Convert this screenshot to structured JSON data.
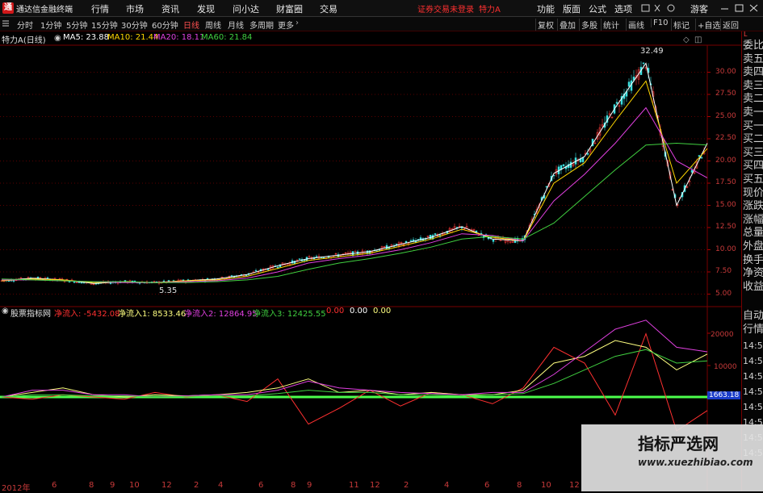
{
  "titlebar": {
    "app_logo": "通",
    "app_title": "通达信金融终端",
    "menus": [
      "行情",
      "市场",
      "资讯",
      "发现",
      "问小达",
      "财富圈",
      "交易"
    ],
    "notice": "证券交易未登录",
    "stock": "特力A",
    "right_items": [
      "功能",
      "版面",
      "公式",
      "选项",
      "游客"
    ]
  },
  "toolbar": {
    "periods": [
      "分时",
      "1分钟",
      "5分钟",
      "15分钟",
      "30分钟",
      "60分钟",
      "日线",
      "周线",
      "月线",
      "多周期",
      "更多"
    ],
    "active_period": "日线",
    "buttons": [
      "复权",
      "叠加",
      "多股",
      "统计",
      "画线",
      "F10",
      "标记",
      "+自选",
      "返回"
    ]
  },
  "main_indicator": {
    "name": "特力A(日线)",
    "ma": [
      {
        "label": "MA5: 23.88",
        "color": "#ffffff"
      },
      {
        "label": "MA10: 21.44",
        "color": "#ffd700"
      },
      {
        "label": "MA20: 18.11",
        "color": "#e040e0"
      },
      {
        "label": "MA60: 21.84",
        "color": "#40d040"
      }
    ],
    "high_label": "32.49",
    "low_label": "5.35",
    "price_axis": [
      "30.00",
      "27.50",
      "25.00",
      "22.50",
      "20.00",
      "17.50",
      "15.00",
      "12.50",
      "10.00",
      "7.50",
      "5.00"
    ]
  },
  "sub_indicator": {
    "name": "股票指标网",
    "items": [
      {
        "label": "净流入: -5432.08",
        "color": "#ff3030"
      },
      {
        "label": "净流入1: 8533.46",
        "color": "#ffff80"
      },
      {
        "label": "净流入2: 12864.95",
        "color": "#e040e0"
      },
      {
        "label": "净流入3: 12425.55",
        "color": "#40d040"
      },
      {
        "label": "0.00",
        "color": "#ff3030"
      },
      {
        "label": "0.00",
        "color": "#ffffff"
      },
      {
        "label": "0.00",
        "color": "#ffff80"
      }
    ],
    "axis": [
      "20000",
      "10000"
    ],
    "current_value": "1663.18"
  },
  "right_panel": {
    "items": [
      "委比",
      "卖五",
      "卖四",
      "卖三",
      "卖二",
      "卖一",
      "买一",
      "买二",
      "买三",
      "买四",
      "买五",
      "现价",
      "涨跌",
      "涨幅",
      "总量",
      "外盘",
      "换手",
      "净资",
      "收益"
    ],
    "lower_items": [
      "自动",
      "行情"
    ],
    "times": [
      "14:5",
      "14:5",
      "14:5",
      "14:5",
      "14:5",
      "14:5",
      "14:5",
      "14:5"
    ]
  },
  "x_axis": [
    "2012年",
    "6",
    "8",
    "9",
    "10",
    "12",
    "2",
    "4",
    "6",
    "8",
    "9",
    "11",
    "12",
    "2",
    "4",
    "6",
    "8",
    "10",
    "12"
  ],
  "watermark": {
    "line1": "指标严选网",
    "line2": "www.xuezhibiao.com"
  },
  "chart_data": {
    "type": "line",
    "series": [
      {
        "name": "MA5",
        "values": [
          6.5,
          6.8,
          6.6,
          6.2,
          6.4,
          6.3,
          6.5,
          6.7,
          7.2,
          8.2,
          9.0,
          9.4,
          9.8,
          10.6,
          11.4,
          12.6,
          11.2,
          11.0,
          18.6,
          20.5,
          26.0,
          31.0,
          15.0,
          22.0
        ]
      },
      {
        "name": "MA10",
        "values": [
          6.5,
          6.7,
          6.6,
          6.3,
          6.4,
          6.3,
          6.5,
          6.6,
          7.0,
          7.9,
          8.8,
          9.2,
          9.6,
          10.4,
          11.2,
          12.3,
          11.4,
          11.0,
          17.5,
          19.8,
          24.5,
          29.0,
          17.5,
          21.4
        ]
      },
      {
        "name": "MA20",
        "values": [
          6.6,
          6.6,
          6.5,
          6.4,
          6.3,
          6.3,
          6.4,
          6.5,
          6.8,
          7.5,
          8.5,
          9.0,
          9.4,
          10.0,
          10.8,
          11.8,
          11.6,
          11.0,
          15.5,
          18.5,
          22.0,
          26.0,
          20.0,
          18.1
        ]
      },
      {
        "name": "MA60",
        "values": [
          6.7,
          6.6,
          6.5,
          6.4,
          6.4,
          6.3,
          6.3,
          6.4,
          6.6,
          7.0,
          7.8,
          8.5,
          9.0,
          9.6,
          10.3,
          11.2,
          11.5,
          11.2,
          13.0,
          16.0,
          19.0,
          21.8,
          22.0,
          21.8
        ]
      }
    ],
    "ylim": [
      4.5,
      32.5
    ]
  }
}
